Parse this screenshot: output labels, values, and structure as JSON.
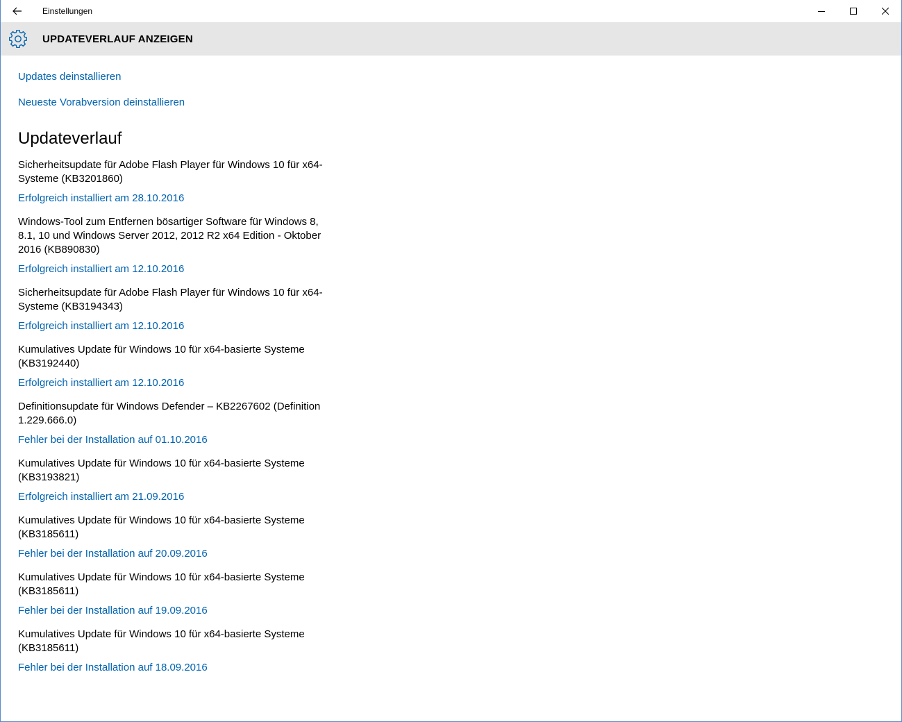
{
  "window": {
    "title": "Einstellungen"
  },
  "header": {
    "title": "UPDATEVERLAUF ANZEIGEN"
  },
  "links": {
    "uninstall_updates": "Updates deinstallieren",
    "uninstall_preview": "Neueste Vorabversion deinstallieren"
  },
  "section": {
    "title": "Updateverlauf"
  },
  "history": [
    {
      "title": "Sicherheitsupdate für Adobe Flash Player für Windows 10 für x64-Systeme (KB3201860)",
      "status": "Erfolgreich installiert am 28.10.2016"
    },
    {
      "title": "Windows-Tool zum Entfernen bösartiger Software für Windows 8, 8.1, 10 und Windows Server 2012, 2012 R2 x64 Edition - Oktober 2016 (KB890830)",
      "status": "Erfolgreich installiert am 12.10.2016"
    },
    {
      "title": "Sicherheitsupdate für Adobe Flash Player für Windows 10 für x64-Systeme (KB3194343)",
      "status": "Erfolgreich installiert am 12.10.2016"
    },
    {
      "title": "Kumulatives Update für Windows 10 für x64-basierte Systeme (KB3192440)",
      "status": "Erfolgreich installiert am 12.10.2016"
    },
    {
      "title": "Definitionsupdate für Windows Defender – KB2267602 (Definition 1.229.666.0)",
      "status": "Fehler bei der Installation auf 01.10.2016"
    },
    {
      "title": "Kumulatives Update für Windows 10 für x64-basierte Systeme (KB3193821)",
      "status": "Erfolgreich installiert am 21.09.2016"
    },
    {
      "title": "Kumulatives Update für Windows 10 für x64-basierte Systeme (KB3185611)",
      "status": "Fehler bei der Installation auf 20.09.2016"
    },
    {
      "title": "Kumulatives Update für Windows 10 für x64-basierte Systeme (KB3185611)",
      "status": "Fehler bei der Installation auf 19.09.2016"
    },
    {
      "title": "Kumulatives Update für Windows 10 für x64-basierte Systeme (KB3185611)",
      "status": "Fehler bei der Installation auf 18.09.2016"
    }
  ],
  "colors": {
    "accent": "#0063b1",
    "header_bg": "#e6e6e6"
  },
  "icons": {
    "back": "back-arrow-icon",
    "settings": "gear-icon",
    "minimize": "minimize-icon",
    "maximize": "maximize-icon",
    "close": "close-icon"
  }
}
